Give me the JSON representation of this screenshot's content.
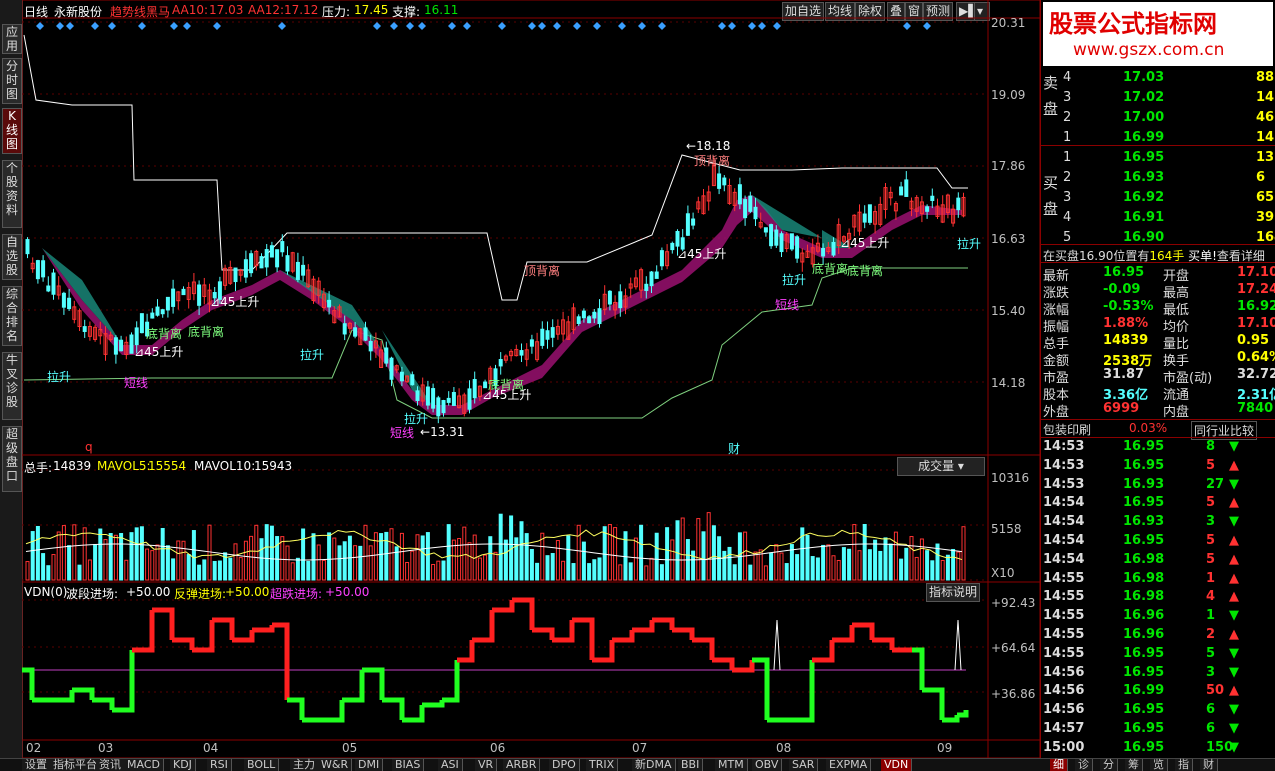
{
  "left_tabs": [
    {
      "label": "应用"
    },
    {
      "label": "分时图"
    },
    {
      "label": "K线图"
    },
    {
      "label": "个股资料"
    },
    {
      "label": "自选股"
    },
    {
      "label": "综合排名"
    },
    {
      "label": "牛叉诊股"
    },
    {
      "label": "超级盘口"
    }
  ],
  "main": {
    "period": "日线",
    "stock": "永新股份",
    "indicator": "趋势线黑马",
    "aa10_label": "AA10:",
    "aa10_value": "17.03",
    "aa12_label": "AA12:",
    "aa12_value": "17.12",
    "pressure_label": "压力:",
    "pressure_value": "17.45",
    "support_label": "支撑:",
    "support_value": "16.11",
    "toolbar": [
      "加自选",
      "均线",
      "除权",
      "叠",
      "窗",
      "预测"
    ],
    "y_axis": [
      "20.31",
      "19.09",
      "17.86",
      "16.63",
      "15.40",
      "14.18"
    ],
    "annotations": {
      "high": "18.18",
      "low": "13.31",
      "top_div": "顶背离",
      "bottom_div_1": "底背离",
      "bottom_div_2": "底背离",
      "bottom_div_3": "底背离",
      "bottom_div_4": "底背离",
      "bottom_div_5": "底背离",
      "pull_1": "拉升",
      "pull_2": "拉升",
      "pull_3": "拉升",
      "pull_4": "拉升",
      "pull_5": "拉升",
      "pull_6": "拉升",
      "short_1": "短线",
      "short_2": "短线",
      "short_3": "短线",
      "up45_1": "45上升",
      "up45_2": "45上升",
      "up45_3": "45上升",
      "up45_4": "45上升",
      "up45_5": "45上升",
      "q": "q",
      "cai": "财"
    }
  },
  "volume": {
    "total_label": "总手:",
    "total_value": "14839",
    "mavol5_label": "MAVOL5:",
    "mavol5_value": "15554",
    "mavol10_label": "MAVOL10:",
    "mavol10_value": "15943",
    "selector": "成交量",
    "y_axis": [
      "10316",
      "5158",
      "X10"
    ]
  },
  "vdn": {
    "name": "VDN(0)",
    "l1": "波段进场:",
    "v1": "+50.00",
    "l2": "反弹进场:",
    "v2": "+50.00",
    "l3": "超跌进场:",
    "v3": "+50.00",
    "help": "指标说明",
    "y_axis": [
      "+92.43",
      "+64.64",
      "+36.86"
    ],
    "x_axis": [
      "02",
      "03",
      "04",
      "05",
      "06",
      "07",
      "08",
      "09"
    ]
  },
  "watermark_1": "股票公式指标网",
  "watermark_2": "www.gszx.com.cn",
  "quote": {
    "sell": [
      {
        "n": "4",
        "p": "17.03",
        "v": "88"
      },
      {
        "n": "3",
        "p": "17.02",
        "v": "14"
      },
      {
        "n": "2",
        "p": "17.00",
        "v": "46"
      },
      {
        "n": "1",
        "p": "16.99",
        "v": "14"
      }
    ],
    "buy": [
      {
        "n": "1",
        "p": "16.95",
        "v": "13"
      },
      {
        "n": "2",
        "p": "16.93",
        "v": "6"
      },
      {
        "n": "3",
        "p": "16.92",
        "v": "65"
      },
      {
        "n": "4",
        "p": "16.91",
        "v": "39"
      },
      {
        "n": "5",
        "p": "16.90",
        "v": "164"
      }
    ],
    "sell_label": "卖盘",
    "buy_label": "买盘",
    "tip": "在买盘16.90位置有",
    "tip_v": "164手",
    "tip_b": "买单!",
    "tip_link": "查看详细",
    "stats": [
      [
        "最新",
        "16.95",
        "开盘",
        "17.10"
      ],
      [
        "涨跌",
        "-0.09",
        "最高",
        "17.24"
      ],
      [
        "涨幅",
        "-0.53%",
        "最低",
        "16.92"
      ],
      [
        "振幅",
        "1.88%",
        "均价",
        "17.10"
      ],
      [
        "总手",
        "14839",
        "量比",
        "0.95"
      ],
      [
        "金额",
        "2538万",
        "换手",
        "0.64%"
      ],
      [
        "市盈",
        "31.87",
        "市盈(动)",
        "32.72"
      ],
      [
        "股本",
        "3.36亿",
        "流通",
        "2.31亿"
      ],
      [
        "外盘",
        "6999",
        "内盘",
        "7840"
      ]
    ],
    "industry": "包装印刷",
    "industry_pct": "0.03%",
    "compare": "同行业比较",
    "ticks": [
      [
        "14:53",
        "16.95",
        "8",
        "d"
      ],
      [
        "14:53",
        "16.95",
        "5",
        "u"
      ],
      [
        "14:53",
        "16.93",
        "27",
        "d"
      ],
      [
        "14:54",
        "16.95",
        "5",
        "u"
      ],
      [
        "14:54",
        "16.93",
        "3",
        "d"
      ],
      [
        "14:54",
        "16.95",
        "5",
        "u"
      ],
      [
        "14:54",
        "16.98",
        "5",
        "u"
      ],
      [
        "14:55",
        "16.98",
        "1",
        "u"
      ],
      [
        "14:55",
        "16.98",
        "4",
        "u"
      ],
      [
        "14:55",
        "16.96",
        "1",
        "d"
      ],
      [
        "14:55",
        "16.96",
        "2",
        "u"
      ],
      [
        "14:55",
        "16.95",
        "5",
        "d"
      ],
      [
        "14:56",
        "16.95",
        "3",
        "d"
      ],
      [
        "14:56",
        "16.99",
        "50",
        "u"
      ],
      [
        "14:56",
        "16.95",
        "6",
        "d"
      ],
      [
        "14:57",
        "16.95",
        "6",
        "d"
      ],
      [
        "15:00",
        "16.95",
        "150",
        "d"
      ]
    ]
  },
  "bottom_tabs": [
    "设置",
    "指标平台",
    "资讯",
    "MACD",
    "KDJ",
    "RSI",
    "BOLL",
    "主力",
    "W&R",
    "DMI",
    "BIAS",
    "ASI",
    "VR",
    "ARBR",
    "DPO",
    "TRIX",
    "新DMA",
    "BBI",
    "MTM",
    "OBV",
    "SAR",
    "EXPMA",
    "VDN"
  ],
  "right_bottom_tabs": [
    "细",
    "诊",
    "分",
    "筹",
    "览",
    "指",
    "财"
  ],
  "colors": {
    "up": "#ff3232",
    "down": "#54ffff",
    "green": "#00e600",
    "bg": "#000000",
    "frame": "#8b0000"
  }
}
